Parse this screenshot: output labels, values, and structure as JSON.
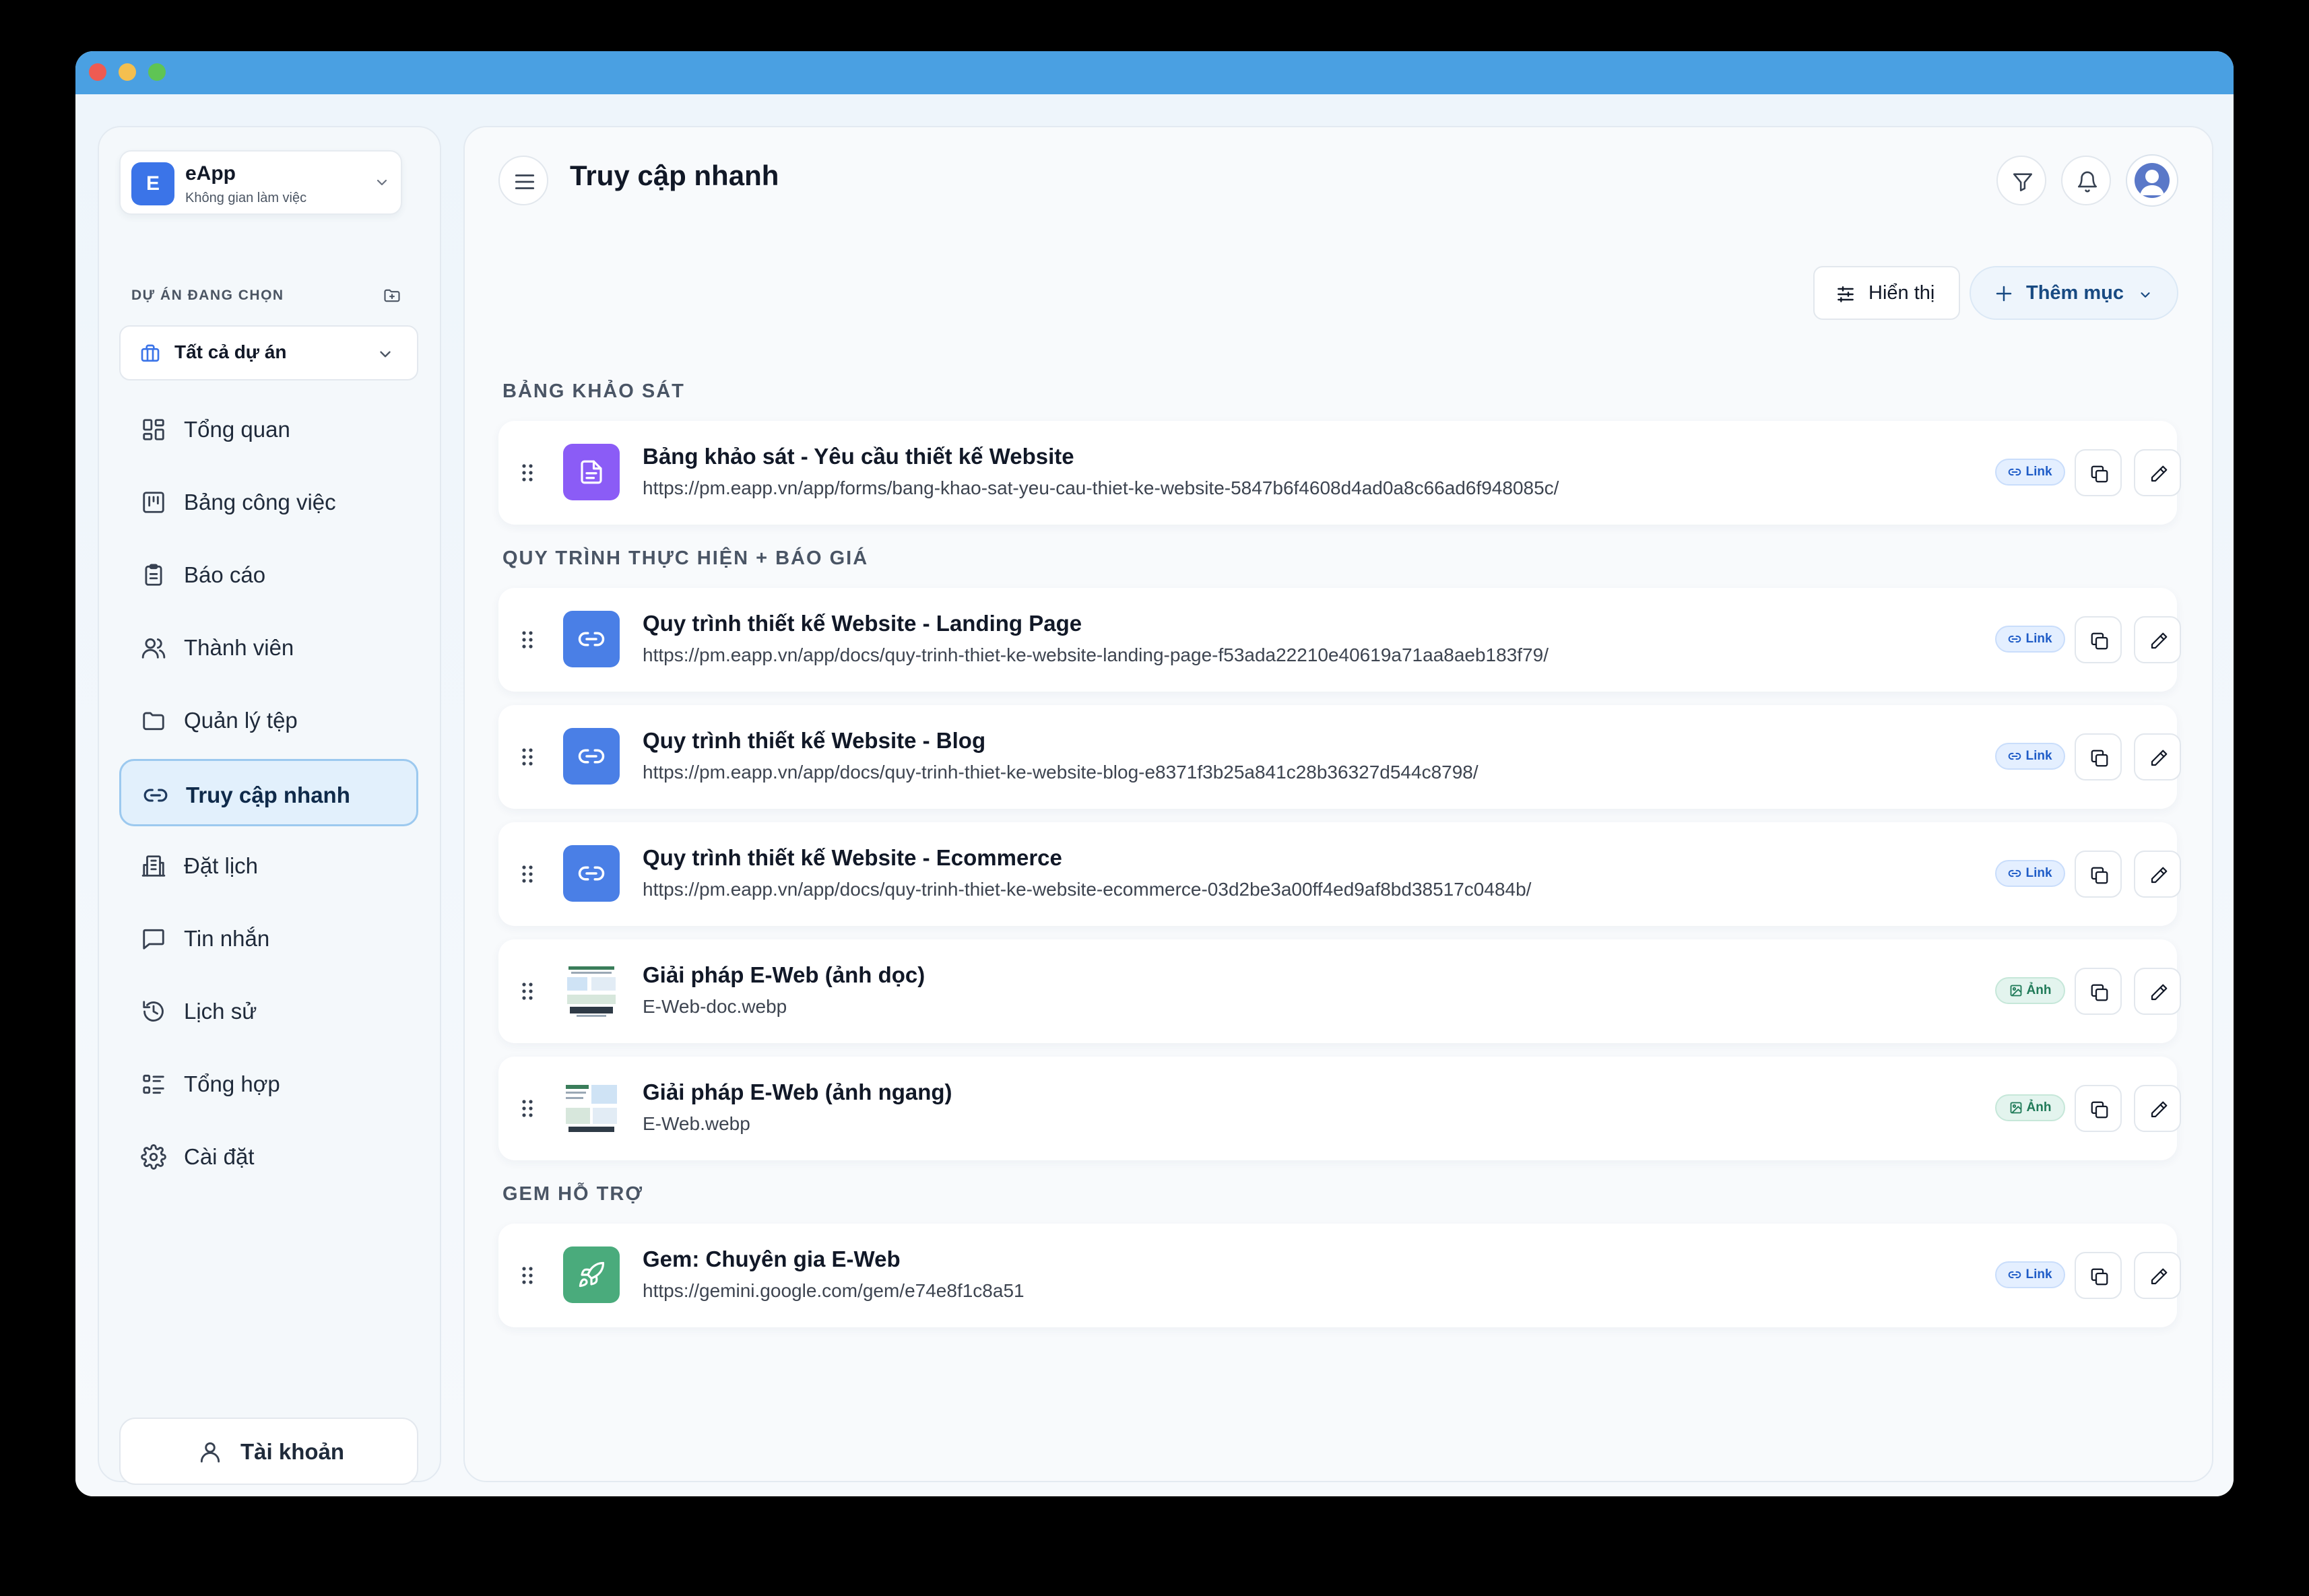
{
  "sidebar": {
    "workspace": {
      "initial": "E",
      "name": "eApp",
      "subtitle": "Không gian làm việc"
    },
    "project_label": "DỰ ÁN ĐANG CHỌN",
    "project_select": "Tất cả dự án",
    "items": [
      {
        "label": "Tổng quan",
        "icon": "dashboard-icon"
      },
      {
        "label": "Bảng công việc",
        "icon": "kanban-icon"
      },
      {
        "label": "Báo cáo",
        "icon": "clipboard-icon"
      },
      {
        "label": "Thành viên",
        "icon": "users-icon"
      },
      {
        "label": "Quản lý tệp",
        "icon": "folder-icon"
      },
      {
        "label": "Truy cập nhanh",
        "icon": "link-icon",
        "active": true
      },
      {
        "label": "Đặt lịch",
        "icon": "building-icon"
      },
      {
        "label": "Tin nhắn",
        "icon": "message-icon"
      },
      {
        "label": "Lịch sử",
        "icon": "history-icon"
      },
      {
        "label": "Tổng hợp",
        "icon": "list-icon"
      },
      {
        "label": "Cài đặt",
        "icon": "gear-icon"
      }
    ],
    "account_label": "Tài khoản"
  },
  "header": {
    "title": "Truy cập nhanh"
  },
  "toolbar": {
    "display_label": "Hiển thị",
    "add_label": "Thêm mục"
  },
  "sections": [
    {
      "title": "BẢNG KHẢO SÁT",
      "items": [
        {
          "title": "Bảng khảo sát - Yêu cầu thiết kế Website",
          "url": "https://pm.eapp.vn/app/forms/bang-khao-sat-yeu-cau-thiet-ke-website-5847b6f4608d4ad0a8c66ad6f948085c/",
          "badge": "Link",
          "icon": "document-icon",
          "color": "#8b5cf6"
        }
      ]
    },
    {
      "title": "QUY TRÌNH THỰC HIỆN + BÁO GIÁ",
      "items": [
        {
          "title": "Quy trình thiết kế Website - Landing Page",
          "url": "https://pm.eapp.vn/app/docs/quy-trinh-thiet-ke-website-landing-page-f53ada22210e40619a71aa8aeb183f79/",
          "badge": "Link",
          "icon": "link-icon",
          "color": "#4a7fe6"
        },
        {
          "title": "Quy trình thiết kế Website - Blog",
          "url": "https://pm.eapp.vn/app/docs/quy-trinh-thiet-ke-website-blog-e8371f3b25a841c28b36327d544c8798/",
          "badge": "Link",
          "icon": "link-icon",
          "color": "#4a7fe6"
        },
        {
          "title": "Quy trình thiết kế Website - Ecommerce",
          "url": "https://pm.eapp.vn/app/docs/quy-trinh-thiet-ke-website-ecommerce-03d2be3a00ff4ed9af8bd38517c0484b/",
          "badge": "Link",
          "icon": "link-icon",
          "color": "#4a7fe6"
        },
        {
          "title": "Giải pháp E-Web (ảnh dọc)",
          "url": "E-Web-doc.webp",
          "badge": "Ảnh",
          "icon": "image-thumbnail",
          "color": "#ffffff"
        },
        {
          "title": "Giải pháp E-Web (ảnh ngang)",
          "url": "E-Web.webp",
          "badge": "Ảnh",
          "icon": "image-thumbnail",
          "color": "#ffffff"
        }
      ]
    },
    {
      "title": "GEM HỖ TRỢ",
      "items": [
        {
          "title": "Gem: Chuyên gia E-Web",
          "url": "https://gemini.google.com/gem/e74e8f1c8a51",
          "badge": "Link",
          "icon": "rocket-icon",
          "color": "#4aab7c"
        }
      ]
    }
  ]
}
